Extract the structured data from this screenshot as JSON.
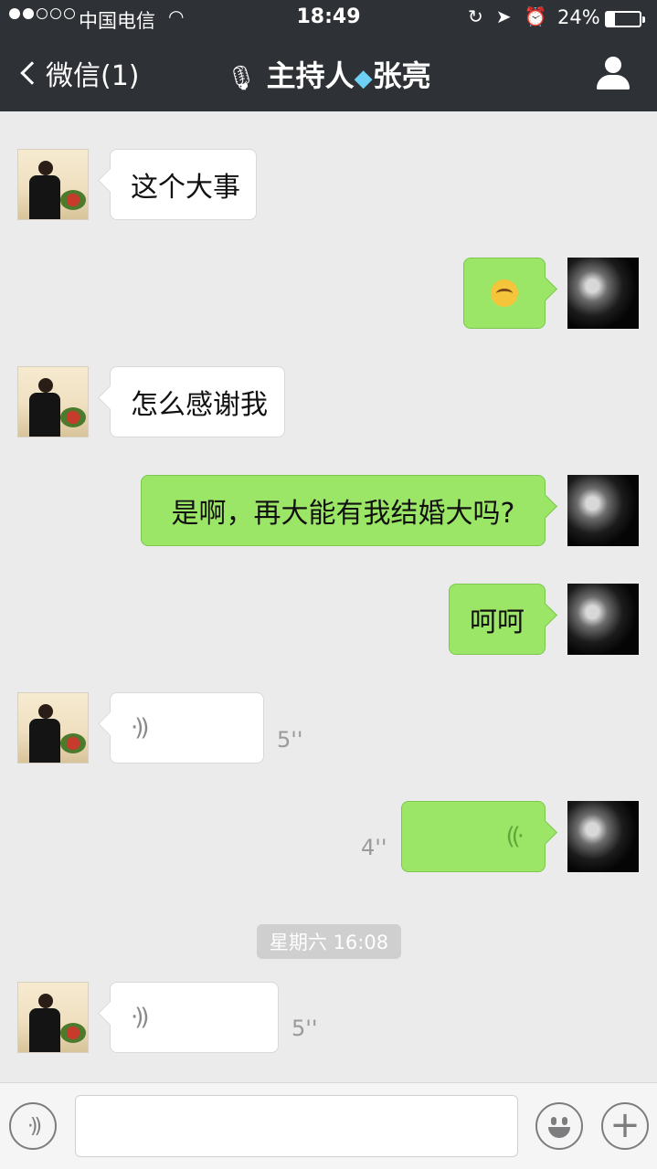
{
  "status_bar": {
    "carrier": "中国电信",
    "time": "18:49",
    "battery": "24%",
    "battery_level": 0.24,
    "signal_bars_filled": 2,
    "signal_bars_total": 5
  },
  "nav": {
    "back_label": "微信(1)",
    "title": "主持人张亮",
    "title_icons": [
      "microphone-icon",
      "diamond-icon"
    ]
  },
  "messages": [
    {
      "side": "left",
      "type": "text",
      "text": "这个大事"
    },
    {
      "side": "right",
      "type": "emoji",
      "emoji": "smirk-emoji-icon"
    },
    {
      "side": "left",
      "type": "text",
      "text": "怎么感谢我"
    },
    {
      "side": "right",
      "type": "text",
      "text": "是啊，再大能有我结婚大吗?"
    },
    {
      "side": "right",
      "type": "text",
      "text": "呵呵"
    },
    {
      "side": "left",
      "type": "voice",
      "duration": "5''"
    },
    {
      "side": "right",
      "type": "voice",
      "duration": "4''"
    },
    {
      "type": "timestamp",
      "text": "星期六 16:08"
    },
    {
      "side": "left",
      "type": "voice",
      "duration": "5''"
    }
  ],
  "input_bar": {
    "voice_button_icon": "voice-icon",
    "emoji_button_icon": "smiley-icon",
    "add_button_icon": "plus-icon",
    "text_value": ""
  },
  "colors": {
    "nav_bg": "#2e3135",
    "chat_bg": "#ebebeb",
    "sent_bubble": "#9ce667",
    "received_bubble": "#ffffff"
  }
}
